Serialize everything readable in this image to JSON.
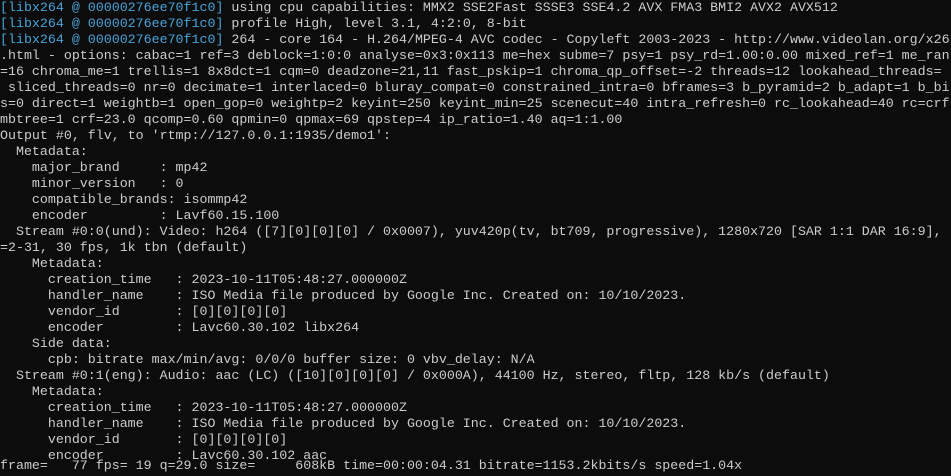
{
  "colors": {
    "background": "#0c0c0c",
    "text": "#cccccc",
    "libx264_prefix": "#4aa3d8"
  },
  "terminal": {
    "lines": [
      {
        "prefix": "[libx264 @ 00000276ee70f1c0]",
        "text": " using cpu capabilities: MMX2 SSE2Fast SSSE3 SSE4.2 AVX FMA3 BMI2 AVX2 AVX512"
      },
      {
        "prefix": "[libx264 @ 00000276ee70f1c0]",
        "text": " profile High, level 3.1, 4:2:0, 8-bit"
      },
      {
        "prefix": "[libx264 @ 00000276ee70f1c0]",
        "text": " 264 - core 164 - H.264/MPEG-4 AVC codec - Copyleft 2003-2023 - http://www.videolan.org/x26"
      },
      {
        "prefix": "",
        "text": ".html - options: cabac=1 ref=3 deblock=1:0:0 analyse=0x3:0x113 me=hex subme=7 psy=1 psy_rd=1.00:0.00 mixed_ref=1 me_ran"
      },
      {
        "prefix": "",
        "text": "=16 chroma_me=1 trellis=1 8x8dct=1 cqm=0 deadzone=21,11 fast_pskip=1 chroma_qp_offset=-2 threads=12 lookahead_threads="
      },
      {
        "prefix": "",
        "text": " sliced_threads=0 nr=0 decimate=1 interlaced=0 bluray_compat=0 constrained_intra=0 bframes=3 b_pyramid=2 b_adapt=1 b_bi"
      },
      {
        "prefix": "",
        "text": "s=0 direct=1 weightb=1 open_gop=0 weightp=2 keyint=250 keyint_min=25 scenecut=40 intra_refresh=0 rc_lookahead=40 rc=crf"
      },
      {
        "prefix": "",
        "text": "mbtree=1 crf=23.0 qcomp=0.60 qpmin=0 qpmax=69 qpstep=4 ip_ratio=1.40 aq=1:1.00"
      },
      {
        "prefix": "",
        "text": "Output #0, flv, to 'rtmp://127.0.0.1:1935/demo1':"
      },
      {
        "prefix": "",
        "text": "  Metadata:"
      },
      {
        "prefix": "",
        "text": "    major_brand     : mp42"
      },
      {
        "prefix": "",
        "text": "    minor_version   : 0"
      },
      {
        "prefix": "",
        "text": "    compatible_brands: isommp42"
      },
      {
        "prefix": "",
        "text": "    encoder         : Lavf60.15.100"
      },
      {
        "prefix": "",
        "text": "  Stream #0:0(und): Video: h264 ([7][0][0][0] / 0x0007), yuv420p(tv, bt709, progressive), 1280x720 [SAR 1:1 DAR 16:9],"
      },
      {
        "prefix": "",
        "text": "=2-31, 30 fps, 1k tbn (default)"
      },
      {
        "prefix": "",
        "text": "    Metadata:"
      },
      {
        "prefix": "",
        "text": "      creation_time   : 2023-10-11T05:48:27.000000Z"
      },
      {
        "prefix": "",
        "text": "      handler_name    : ISO Media file produced by Google Inc. Created on: 10/10/2023."
      },
      {
        "prefix": "",
        "text": "      vendor_id       : [0][0][0][0]"
      },
      {
        "prefix": "",
        "text": "      encoder         : Lavc60.30.102 libx264"
      },
      {
        "prefix": "",
        "text": "    Side data:"
      },
      {
        "prefix": "",
        "text": "      cpb: bitrate max/min/avg: 0/0/0 buffer size: 0 vbv_delay: N/A"
      },
      {
        "prefix": "",
        "text": "  Stream #0:1(eng): Audio: aac (LC) ([10][0][0][0] / 0x000A), 44100 Hz, stereo, fltp, 128 kb/s (default)"
      },
      {
        "prefix": "",
        "text": "    Metadata:"
      },
      {
        "prefix": "",
        "text": "      creation_time   : 2023-10-11T05:48:27.000000Z"
      },
      {
        "prefix": "",
        "text": "      handler_name    : ISO Media file produced by Google Inc. Created on: 10/10/2023."
      },
      {
        "prefix": "",
        "text": "      vendor_id       : [0][0][0][0]"
      },
      {
        "prefix": "",
        "text": "      encoder         : Lavc60.30.102 aac"
      },
      {
        "prefix": "",
        "text": "frame=   77 fps= 19 q=29.0 size=     608kB time=00:00:04.31 bitrate=1153.2kbits/s speed=1.04x"
      }
    ]
  }
}
